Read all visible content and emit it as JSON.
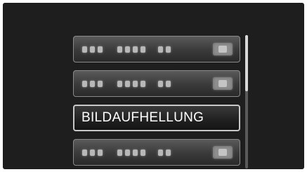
{
  "menu": {
    "items": [
      {
        "label": "",
        "selected": false,
        "icon": "blurred-item-icon"
      },
      {
        "label": "",
        "selected": false,
        "icon": "blurred-item-icon"
      },
      {
        "label": "BILDAUFHELLUNG",
        "selected": true
      },
      {
        "label": "",
        "selected": false,
        "icon": "blurred-item-icon"
      }
    ]
  },
  "scrollbar": {
    "position_fraction": 0.0
  }
}
